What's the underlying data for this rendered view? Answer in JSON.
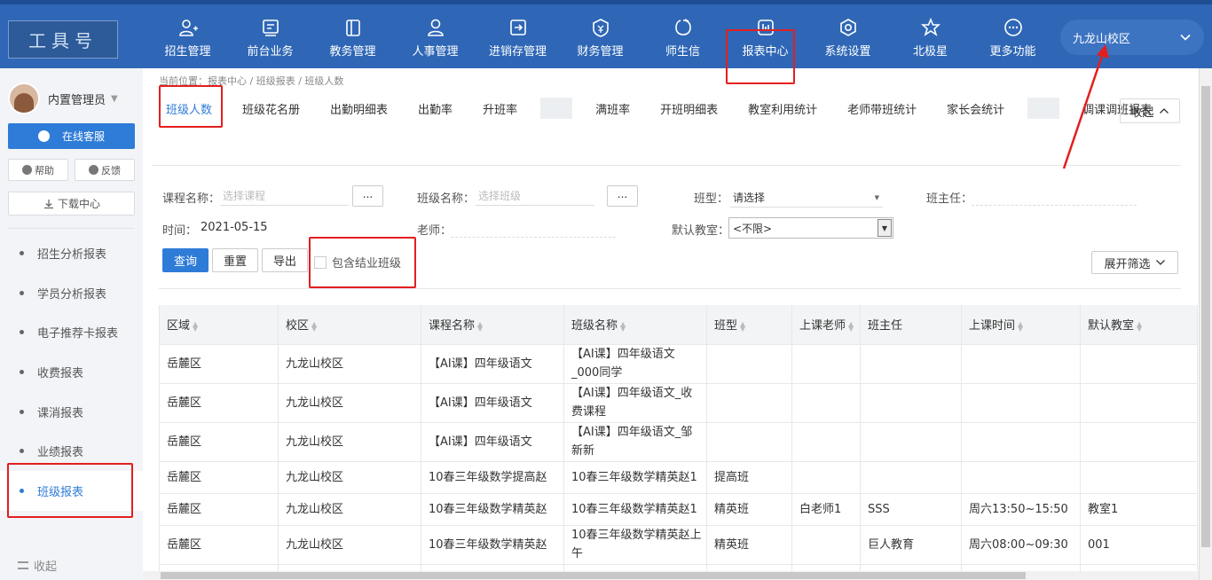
{
  "colors": {
    "topbar": "#2f67b6",
    "accent": "#2f7cd8",
    "highlight": "#e31e1e"
  },
  "logo": {
    "text": "工具号"
  },
  "nav": [
    {
      "label": "招生管理",
      "icon": "add-user-icon"
    },
    {
      "label": "前台业务",
      "icon": "monitor-icon"
    },
    {
      "label": "教务管理",
      "icon": "book-icon"
    },
    {
      "label": "人事管理",
      "icon": "person-icon"
    },
    {
      "label": "进销存管理",
      "icon": "export-icon"
    },
    {
      "label": "财务管理",
      "icon": "finance-icon"
    },
    {
      "label": "师生信",
      "icon": "chat-icon"
    },
    {
      "label": "报表中心",
      "icon": "chart-icon"
    },
    {
      "label": "系统设置",
      "icon": "gear-icon"
    },
    {
      "label": "北极星",
      "icon": "star-icon"
    },
    {
      "label": "更多功能",
      "icon": "more-icon"
    }
  ],
  "campus": {
    "selected": "九龙山校区"
  },
  "sidebar": {
    "user": "内置管理员",
    "online_service": "在线客服",
    "help": "帮助",
    "feedback": "反馈",
    "download": "下载中心",
    "items": [
      {
        "label": "招生分析报表"
      },
      {
        "label": "学员分析报表"
      },
      {
        "label": "电子推荐卡报表"
      },
      {
        "label": "收费报表"
      },
      {
        "label": "课消报表"
      },
      {
        "label": "业绩报表"
      },
      {
        "label": "班级报表"
      }
    ],
    "collapse": "收起"
  },
  "breadcrumb": "当前位置：报表中心 / 班级报表 / 班级人数",
  "tabs": [
    {
      "label": "班级人数"
    },
    {
      "label": "班级花名册"
    },
    {
      "label": "出勤明细表"
    },
    {
      "label": "出勤率"
    },
    {
      "label": "升班率"
    },
    {
      "label": ""
    },
    {
      "label": "满班率"
    },
    {
      "label": "开班明细表"
    },
    {
      "label": "教室利用统计"
    },
    {
      "label": "老师带班统计"
    },
    {
      "label": "家长会统计"
    },
    {
      "label": ""
    },
    {
      "label": "调课调班报表"
    }
  ],
  "collapse_btn": "收起",
  "filters": {
    "course_label": "课程名称：",
    "course_placeholder": "选择课程",
    "class_label": "班级名称：",
    "class_placeholder": "选择班级",
    "dots": "...",
    "type_label": "班型：",
    "type_value": "请选择",
    "head_teacher_label": "班主任：",
    "time_label": "时间：",
    "time_value": "2021-05-15",
    "teacher_label": "老师：",
    "room_label": "默认教室：",
    "room_value": "<不限>"
  },
  "actions": {
    "query": "查询",
    "reset": "重置",
    "export": "导出",
    "include_closed": "包含结业班级",
    "expand": "展开筛选"
  },
  "table": {
    "columns": [
      "区域",
      "校区",
      "课程名称",
      "班级名称",
      "班型",
      "上课老师",
      "班主任",
      "上课时间",
      "默认教室"
    ],
    "rows": [
      [
        "岳麓区",
        "九龙山校区",
        "【AI课】四年级语文",
        "【AI课】四年级语文_000同学",
        "",
        "",
        "",
        "",
        ""
      ],
      [
        "岳麓区",
        "九龙山校区",
        "【AI课】四年级语文",
        "【AI课】四年级语文_收费课程",
        "",
        "",
        "",
        "",
        ""
      ],
      [
        "岳麓区",
        "九龙山校区",
        "【AI课】四年级语文",
        "【AI课】四年级语文_邹新新",
        "",
        "",
        "",
        "",
        ""
      ],
      [
        "岳麓区",
        "九龙山校区",
        "10春三年级数学提高赵",
        "10春三年级数学精英赵1",
        "提高班",
        "",
        "",
        "",
        ""
      ],
      [
        "岳麓区",
        "九龙山校区",
        "10春三年级数学精英赵",
        "10春三年级数学精英赵1",
        "精英班",
        "白老师1",
        "SSS",
        "周六13:50~15:50",
        "教室1"
      ],
      [
        "岳麓区",
        "九龙山校区",
        "10春三年级数学精英赵",
        "10春三年级数学精英赵上午",
        "精英班",
        "",
        "巨人教育",
        "周六08:00~09:30",
        "001"
      ],
      [
        "",
        "",
        "",
        "",
        "",
        "",
        "",
        "",
        ""
      ]
    ]
  }
}
